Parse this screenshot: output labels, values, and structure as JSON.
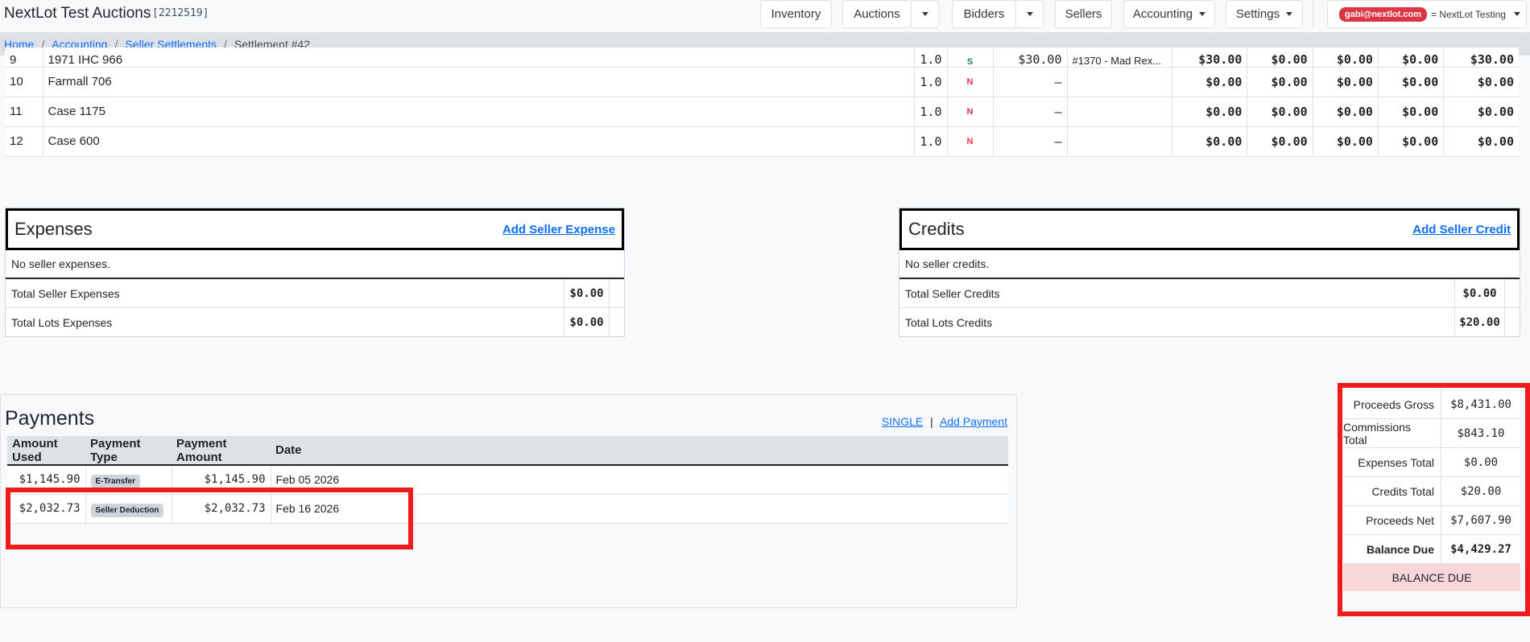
{
  "header": {
    "brand": "NextLot Test Auctions",
    "account_id": "[2212519]",
    "nav": {
      "inventory": "Inventory",
      "auctions": "Auctions",
      "bidders": "Bidders",
      "sellers": "Sellers",
      "accounting": "Accounting",
      "settings": "Settings"
    },
    "user_email": "gabi@nextlot.com",
    "user_org": "= NextLot Testing"
  },
  "breadcrumb": {
    "home": "Home",
    "accounting": "Accounting",
    "seller_settlements": "Seller Settlements",
    "current": "Settlement #42"
  },
  "lots": [
    {
      "no": "9",
      "title": "1971 IHC 966",
      "qty": "1.0",
      "status": "S",
      "price": "$30.00",
      "buyer": "#1370 - Mad Rex...",
      "a1": "$30.00",
      "a2": "$0.00",
      "a3": "$0.00",
      "a4": "$0.00",
      "a5": "$30.00"
    },
    {
      "no": "10",
      "title": "Farmall 706",
      "qty": "1.0",
      "status": "N",
      "price": "–",
      "buyer": "",
      "a1": "$0.00",
      "a2": "$0.00",
      "a3": "$0.00",
      "a4": "$0.00",
      "a5": "$0.00"
    },
    {
      "no": "11",
      "title": "Case 1175",
      "qty": "1.0",
      "status": "N",
      "price": "–",
      "buyer": "",
      "a1": "$0.00",
      "a2": "$0.00",
      "a3": "$0.00",
      "a4": "$0.00",
      "a5": "$0.00"
    },
    {
      "no": "12",
      "title": "Case 600",
      "qty": "1.0",
      "status": "N",
      "price": "–",
      "buyer": "",
      "a1": "$0.00",
      "a2": "$0.00",
      "a3": "$0.00",
      "a4": "$0.00",
      "a5": "$0.00"
    }
  ],
  "expenses": {
    "title": "Expenses",
    "add_link": "Add Seller Expense",
    "empty": "No seller expenses.",
    "total_seller_label": "Total Seller Expenses",
    "total_seller_value": "$0.00",
    "total_lots_label": "Total Lots Expenses",
    "total_lots_value": "$0.00"
  },
  "credits": {
    "title": "Credits",
    "add_link": "Add Seller Credit",
    "empty": "No seller credits.",
    "total_seller_label": "Total Seller Credits",
    "total_seller_value": "$0.00",
    "total_lots_label": "Total Lots Credits",
    "total_lots_value": "$20.00"
  },
  "payments": {
    "title": "Payments",
    "single_link": "SINGLE",
    "divider": "|",
    "add_link": "Add Payment",
    "columns": {
      "amount_used": "Amount Used",
      "payment_type": "Payment Type",
      "payment_amount": "Payment Amount",
      "date": "Date"
    },
    "rows": [
      {
        "amount_used": "$1,145.90",
        "type": "E-Transfer",
        "amount": "$1,145.90",
        "date": "Feb 05 2026"
      },
      {
        "amount_used": "$2,032.73",
        "type": "Seller Deduction",
        "amount": "$2,032.73",
        "date": "Feb 16 2026"
      }
    ]
  },
  "summary": {
    "proceeds_gross_label": "Proceeds Gross",
    "proceeds_gross": "$8,431.00",
    "commissions_label": "Commissions Total",
    "commissions": "$843.10",
    "expenses_label": "Expenses Total",
    "expenses": "$0.00",
    "credits_label": "Credits Total",
    "credits": "$20.00",
    "net_label": "Proceeds Net",
    "net": "$7,607.90",
    "balance_label": "Balance Due",
    "balance": "$4,429.27",
    "banner": "BALANCE DUE"
  },
  "colors": {
    "annotation": "#ee1c1c",
    "link": "#0d6efd",
    "balance_banner": "#f8d7da"
  }
}
